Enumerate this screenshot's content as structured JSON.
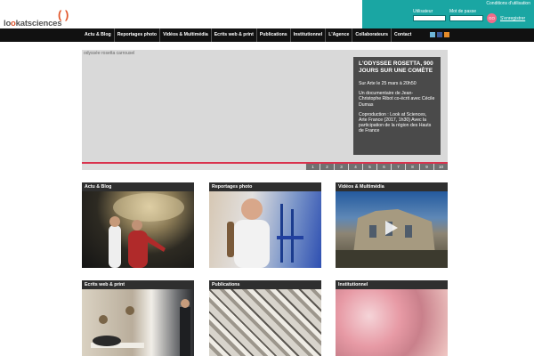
{
  "header": {
    "logo": {
      "prefix": "lo",
      "accent": "o",
      "middle": "kat",
      "suffix": "sciences",
      "bracket": "( )"
    }
  },
  "login": {
    "conditions_link": "Conditions d'utilisation",
    "user_label": "Utilisateur",
    "password_label": "Mot de passe",
    "submit_label": "GO",
    "register_link": "S'enregistrer"
  },
  "nav": {
    "items": [
      "Actu & Blog",
      "Reportages photo",
      "Vidéos & Multimédia",
      "Ecrits web & print",
      "Publications",
      "Institutionnel",
      "L'Agence",
      "Collaborateurs",
      "Contact"
    ],
    "social_icons": [
      "twitter-icon",
      "facebook-icon",
      "rss-icon"
    ]
  },
  "carousel": {
    "alt_text": "odyssée rosetta carrousel",
    "title": "L'ODYSSEE ROSETTA, 900 jours sur une comète",
    "paragraphs": [
      "Sur Arte le 25 mars à 20h50",
      "Un documentaire de Jean-Christophe Ribot co-écrit avec Cécile Dumas",
      "Coproduction : Look at Sciences, Arte France (2017, 1h30) Avec la participation de la région des Hauts de France"
    ],
    "pages": [
      "1",
      "2",
      "3",
      "4",
      "5",
      "6",
      "7",
      "8",
      "9",
      "10"
    ]
  },
  "tiles": [
    {
      "title": "Actu & Blog"
    },
    {
      "title": "Reportages photo"
    },
    {
      "title": "Vidéos & Multimédia"
    },
    {
      "title": "Ecrits web & print"
    },
    {
      "title": "Publications"
    },
    {
      "title": "Institutionnel"
    }
  ],
  "colors": {
    "accent_teal": "#1aa6a3",
    "nav_black": "#111111",
    "carousel_red": "#d9324d",
    "logo_orange": "#e2572c"
  }
}
